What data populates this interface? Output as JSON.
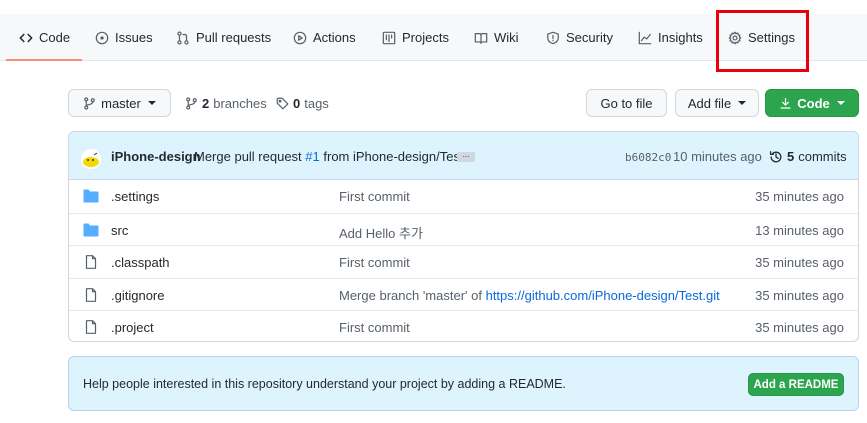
{
  "nav": {
    "tabs": [
      {
        "label": "Code",
        "icon": "code-icon"
      },
      {
        "label": "Issues",
        "icon": "issue-icon"
      },
      {
        "label": "Pull requests",
        "icon": "pull-request-icon"
      },
      {
        "label": "Actions",
        "icon": "play-icon"
      },
      {
        "label": "Projects",
        "icon": "project-board-icon"
      },
      {
        "label": "Wiki",
        "icon": "book-icon"
      },
      {
        "label": "Security",
        "icon": "shield-icon"
      },
      {
        "label": "Insights",
        "icon": "graph-icon"
      },
      {
        "label": "Settings",
        "icon": "gear-icon"
      }
    ],
    "active_tab": "Code",
    "highlighted_tab": "Settings"
  },
  "branch_bar": {
    "branch_label": "master",
    "branches_count": "2",
    "branches_label": "branches",
    "tags_count": "0",
    "tags_label": "tags",
    "goto_file_label": "Go to file",
    "add_file_label": "Add file",
    "code_label": "Code"
  },
  "latest_commit": {
    "author": "iPhone-design",
    "message_prefix": "Merge pull request",
    "pr_link": "#1",
    "message_suffix": "from iPhone-design/Test",
    "ellipsis": "...",
    "sha": "b6082c0",
    "time": "10 minutes ago",
    "commit_count": "5",
    "commit_label": "commits"
  },
  "files": [
    {
      "name": ".settings",
      "type": "folder",
      "message": "First commit",
      "message_link": "",
      "time": "35 minutes ago"
    },
    {
      "name": "src",
      "type": "folder",
      "message": "Add Hello 추가",
      "message_link": "",
      "time": "13 minutes ago"
    },
    {
      "name": ".classpath",
      "type": "file",
      "message": "First commit",
      "message_link": "",
      "time": "35 minutes ago"
    },
    {
      "name": ".gitignore",
      "type": "file",
      "message": "Merge branch 'master' of ",
      "message_link": "https://github.com/iPhone-design/Test.git",
      "time": "35 minutes ago"
    },
    {
      "name": ".project",
      "type": "file",
      "message": "First commit",
      "message_link": "",
      "time": "35 minutes ago"
    }
  ],
  "readme_banner": {
    "text": "Help people interested in this repository understand your project by adding a README.",
    "button_label": "Add a README"
  },
  "colors": {
    "accent_green": "#2da44e",
    "link_blue": "#0969da",
    "folder_blue": "#54aeff",
    "highlight_red": "#e8000b",
    "active_tab_underline": "#fd8c73"
  }
}
